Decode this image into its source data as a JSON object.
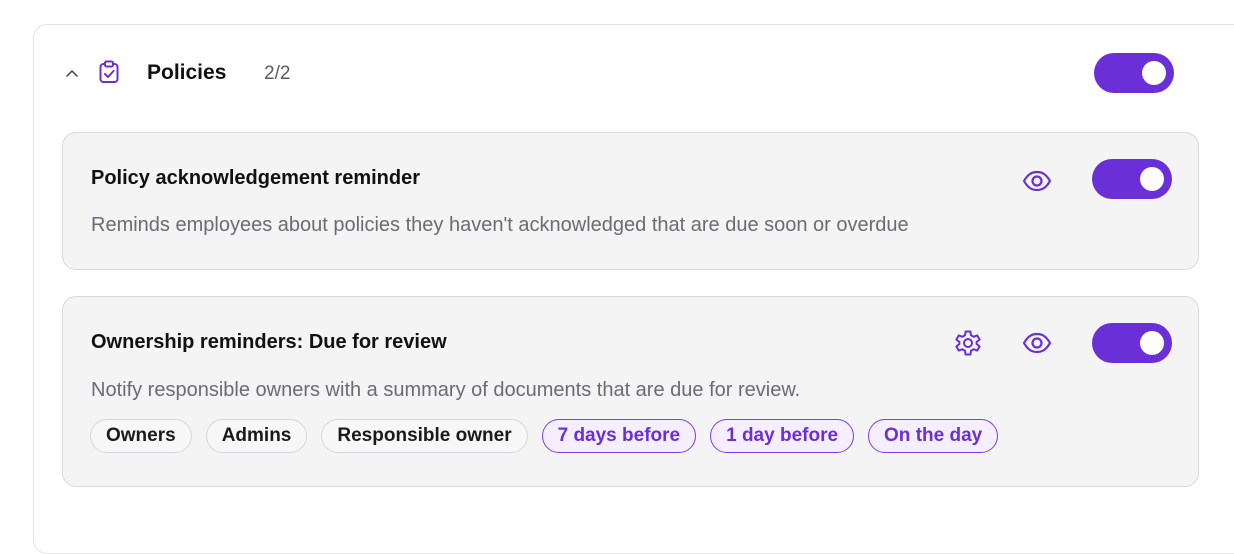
{
  "section": {
    "title": "Policies",
    "count": "2/2",
    "chevron_icon": "chevron-up-icon",
    "section_icon": "clipboard-check-icon",
    "enabled": true
  },
  "colors": {
    "accent": "#6a2fd6",
    "card_background": "#f4f4f5",
    "muted_text": "#6b6b73"
  },
  "cards": [
    {
      "title": "Policy acknowledgement reminder",
      "description": "Reminds employees about policies they haven't acknowledged that are due soon or overdue",
      "icons": [
        "eye-icon"
      ],
      "enabled": true
    },
    {
      "title": "Ownership reminders: Due for review",
      "description": "Notify responsible owners with a summary of documents that are due for review.",
      "icons": [
        "gear-icon",
        "eye-icon"
      ],
      "enabled": true,
      "recipients": [
        "Owners",
        "Admins",
        "Responsible owner"
      ],
      "schedule": [
        "7 days before",
        "1 day before",
        "On the day"
      ]
    }
  ]
}
